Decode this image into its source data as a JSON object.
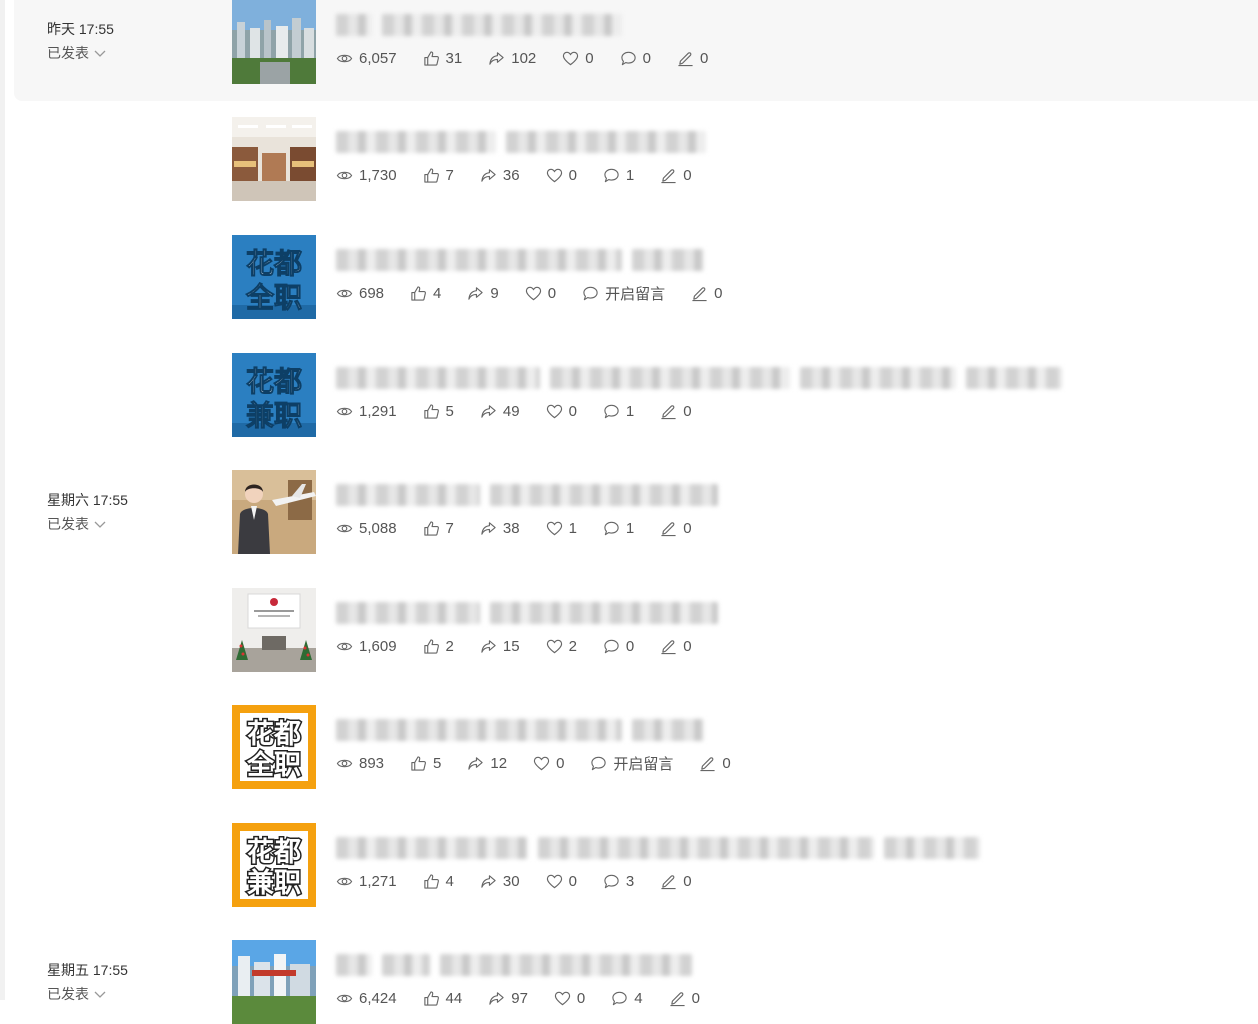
{
  "groups": [
    {
      "time": "昨天 17:55",
      "status": "已发表"
    },
    {
      "time": "星期六 17:55",
      "status": "已发表"
    },
    {
      "time": "星期五 17:55",
      "status": "已发表"
    }
  ],
  "thumbnails": [
    {
      "type": "photo",
      "subject": "city skyline"
    },
    {
      "type": "photo",
      "subject": "jewelry store interior"
    },
    {
      "type": "text-tile",
      "line1": "花都",
      "line2": "全职",
      "bg": "#2b7fc1",
      "fg": "#ffffff"
    },
    {
      "type": "text-tile",
      "line1": "花都",
      "line2": "兼职",
      "bg": "#2b7fc1",
      "fg": "#ffffff"
    },
    {
      "type": "photo",
      "subject": "flight attendant with airplane model"
    },
    {
      "type": "photo",
      "subject": "company reception lobby"
    },
    {
      "type": "text-tile",
      "line1": "花都",
      "line2": "全职",
      "bg": "#f5a10f",
      "fg": "#222222"
    },
    {
      "type": "text-tile",
      "line1": "花都",
      "line2": "兼职",
      "bg": "#f5a10f",
      "fg": "#222222"
    },
    {
      "type": "photo",
      "subject": "school campus buildings"
    }
  ],
  "articles": [
    {
      "views": "6,057",
      "likes": "31",
      "shares": "102",
      "favorites": "0",
      "comments": "0",
      "notes": "0"
    },
    {
      "views": "1,730",
      "likes": "7",
      "shares": "36",
      "favorites": "0",
      "comments": "1",
      "notes": "0"
    },
    {
      "views": "698",
      "likes": "4",
      "shares": "9",
      "favorites": "0",
      "comments": "开启留言",
      "notes": "0"
    },
    {
      "views": "1,291",
      "likes": "5",
      "shares": "49",
      "favorites": "0",
      "comments": "1",
      "notes": "0"
    },
    {
      "views": "5,088",
      "likes": "7",
      "shares": "38",
      "favorites": "1",
      "comments": "1",
      "notes": "0"
    },
    {
      "views": "1,609",
      "likes": "2",
      "shares": "15",
      "favorites": "2",
      "comments": "0",
      "notes": "0"
    },
    {
      "views": "893",
      "likes": "5",
      "shares": "12",
      "favorites": "0",
      "comments": "开启留言",
      "notes": "0"
    },
    {
      "views": "1,271",
      "likes": "4",
      "shares": "30",
      "favorites": "0",
      "comments": "3",
      "notes": "0"
    },
    {
      "views": "6,424",
      "likes": "44",
      "shares": "97",
      "favorites": "0",
      "comments": "4",
      "notes": "0"
    }
  ],
  "colors": {
    "text": "#333333",
    "muted": "#555555",
    "highlight_bg": "#f7f7f7",
    "icon": "#666666"
  }
}
